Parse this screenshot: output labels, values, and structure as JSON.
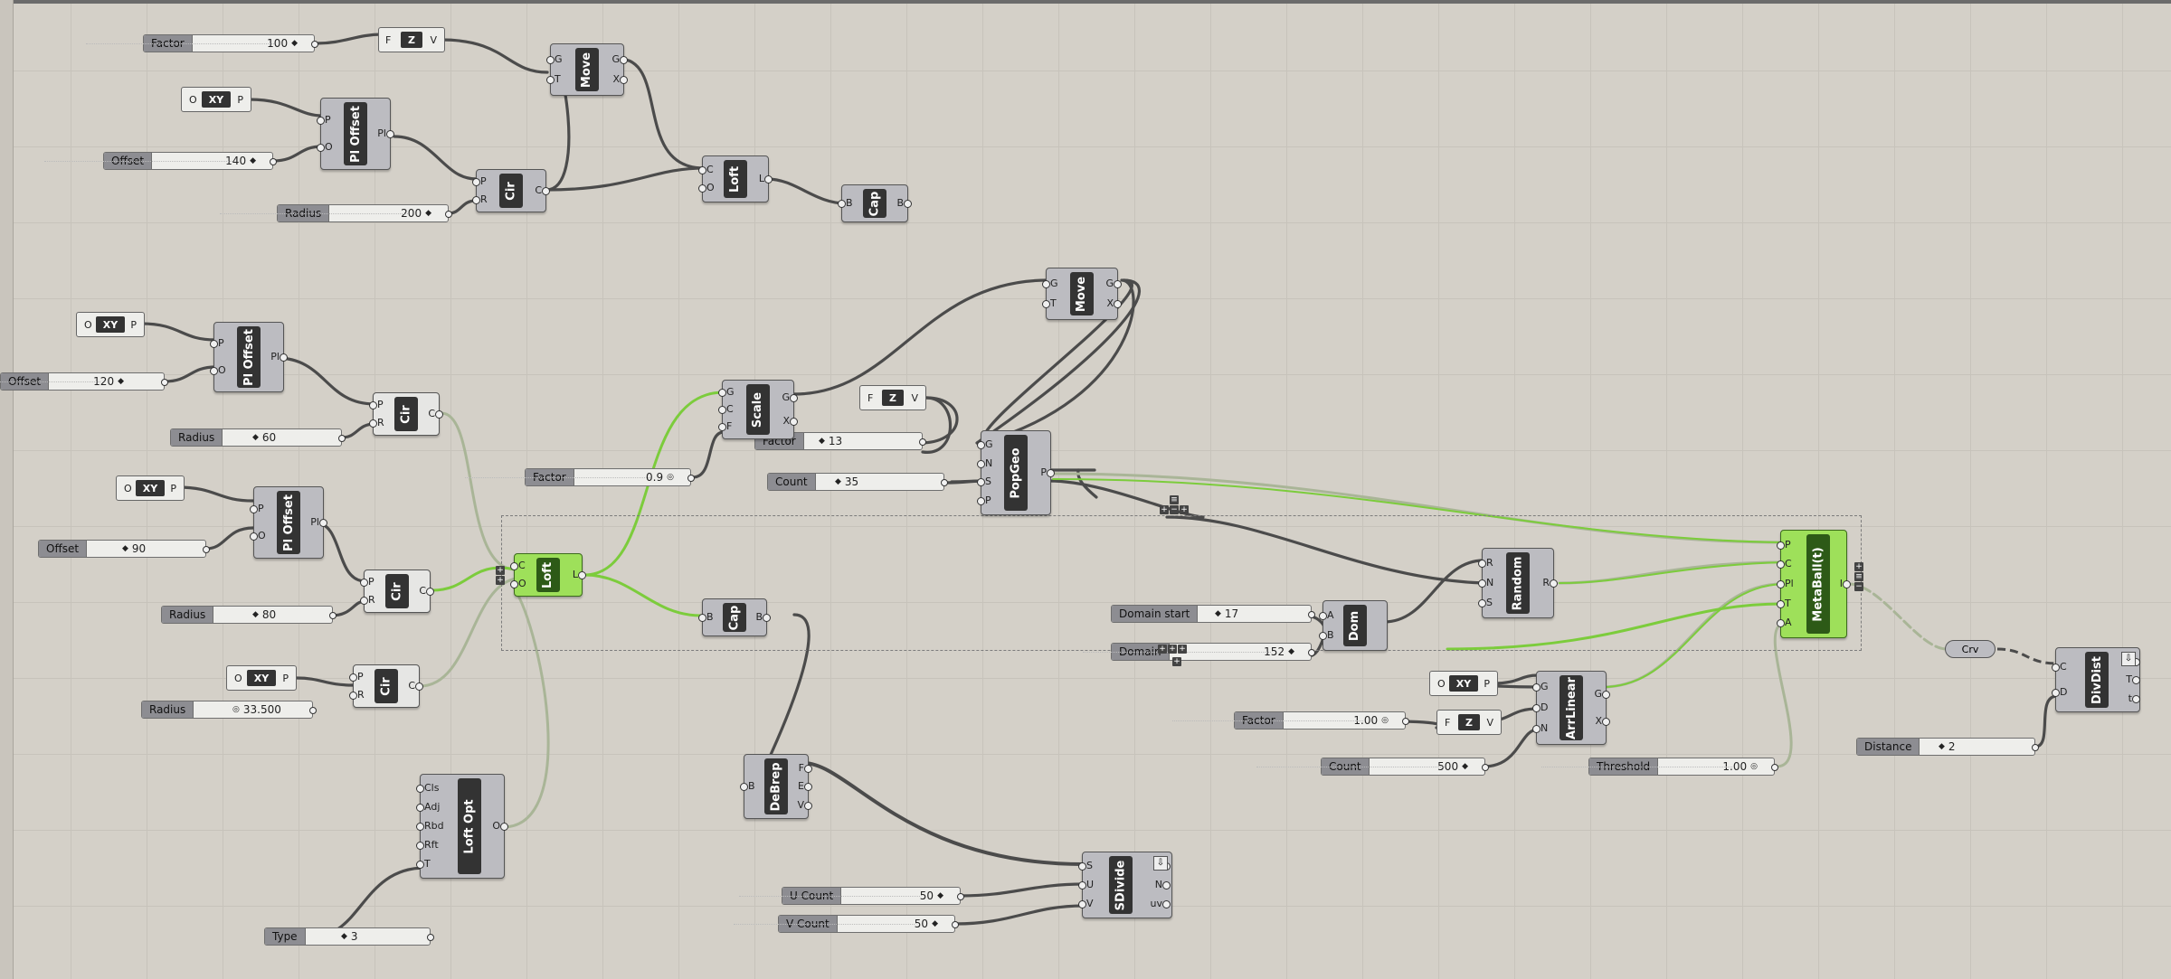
{
  "canvas": {
    "background": "#d4d0c8",
    "wire_color": "#4b4b4b",
    "selected_wire_color": "#7ccc3c",
    "selected_node_color": "#9ee05a"
  },
  "sliders": {
    "factor100": {
      "label": "Factor",
      "value": "100"
    },
    "offset140": {
      "label": "Offset",
      "value": "140"
    },
    "radius200": {
      "label": "Radius",
      "value": "200"
    },
    "offset120": {
      "label": "Offset",
      "value": "120"
    },
    "radius60": {
      "label": "Radius",
      "value": "60"
    },
    "offset90": {
      "label": "Offset",
      "value": "90"
    },
    "radius80": {
      "label": "Radius",
      "value": "80"
    },
    "radius33": {
      "label": "Radius",
      "value": "33.500"
    },
    "type3": {
      "label": "Type",
      "value": "3"
    },
    "factor09": {
      "label": "Factor",
      "value": "0.9"
    },
    "factor13": {
      "label": "Factor",
      "value": "13"
    },
    "count35": {
      "label": "Count",
      "value": "35"
    },
    "domainStart": {
      "label": "Domain start",
      "value": "17"
    },
    "domainEnd": {
      "label": "Domain",
      "value": "152"
    },
    "factor100b": {
      "label": "Factor",
      "value": "1.00"
    },
    "count500": {
      "label": "Count",
      "value": "500"
    },
    "threshold": {
      "label": "Threshold",
      "value": "1.00"
    },
    "ucount": {
      "label": "U Count",
      "value": "50"
    },
    "vcount": {
      "label": "V Count",
      "value": "50"
    },
    "distance": {
      "label": "Distance",
      "value": "2"
    }
  },
  "nodes": {
    "z1": {
      "title": "Z",
      "inputs": [
        "F"
      ],
      "outputs": [
        "V"
      ]
    },
    "xy1": {
      "title": "XY",
      "inputs": [
        "O"
      ],
      "outputs": [
        "P"
      ]
    },
    "ploffset1": {
      "title": "Pl Offset",
      "inputs": [
        "P",
        "O"
      ],
      "outputs": [
        "Pl"
      ]
    },
    "move1": {
      "title": "Move",
      "inputs": [
        "G",
        "T"
      ],
      "outputs": [
        "G",
        "X"
      ]
    },
    "cir1": {
      "title": "Cir",
      "inputs": [
        "P",
        "R"
      ],
      "outputs": [
        "C"
      ]
    },
    "loft1": {
      "title": "Loft",
      "inputs": [
        "C",
        "O"
      ],
      "outputs": [
        "L"
      ]
    },
    "cap1": {
      "title": "Cap",
      "inputs": [
        "B"
      ],
      "outputs": [
        "B"
      ]
    },
    "xy2": {
      "title": "XY",
      "inputs": [
        "O"
      ],
      "outputs": [
        "P"
      ]
    },
    "ploffset2": {
      "title": "Pl Offset",
      "inputs": [
        "P",
        "O"
      ],
      "outputs": [
        "Pl"
      ]
    },
    "cir2": {
      "title": "Cir",
      "inputs": [
        "P",
        "R"
      ],
      "outputs": [
        "C"
      ]
    },
    "xy3": {
      "title": "XY",
      "inputs": [
        "O"
      ],
      "outputs": [
        "P"
      ]
    },
    "ploffset3": {
      "title": "Pl Offset",
      "inputs": [
        "P",
        "O"
      ],
      "outputs": [
        "Pl"
      ]
    },
    "cir3": {
      "title": "Cir",
      "inputs": [
        "P",
        "R"
      ],
      "outputs": [
        "C"
      ]
    },
    "xy4": {
      "title": "XY",
      "inputs": [
        "O"
      ],
      "outputs": [
        "P"
      ]
    },
    "cir4": {
      "title": "Cir",
      "inputs": [
        "P",
        "R"
      ],
      "outputs": [
        "C"
      ]
    },
    "loftopt": {
      "title": "Loft Opt",
      "inputs": [
        "Cls",
        "Adj",
        "Rbd",
        "Rft",
        "T"
      ],
      "outputs": [
        "O"
      ]
    },
    "loft2": {
      "title": "Loft",
      "inputs": [
        "C",
        "O"
      ],
      "outputs": [
        "L"
      ]
    },
    "scale": {
      "title": "Scale",
      "inputs": [
        "G",
        "C",
        "F"
      ],
      "outputs": [
        "G",
        "X"
      ]
    },
    "z2": {
      "title": "Z",
      "inputs": [
        "F"
      ],
      "outputs": [
        "V"
      ]
    },
    "move2": {
      "title": "Move",
      "inputs": [
        "G",
        "T"
      ],
      "outputs": [
        "G",
        "X"
      ]
    },
    "popgeo": {
      "title": "PopGeo",
      "inputs": [
        "G",
        "N",
        "S",
        "P"
      ],
      "outputs": [
        "P"
      ]
    },
    "cap2": {
      "title": "Cap",
      "inputs": [
        "B"
      ],
      "outputs": [
        "B"
      ]
    },
    "debrep": {
      "title": "DeBrep",
      "inputs": [
        "B"
      ],
      "outputs": [
        "F",
        "E",
        "V"
      ]
    },
    "sdivide": {
      "title": "SDivide",
      "inputs": [
        "S",
        "U",
        "V"
      ],
      "outputs": [
        "P",
        "N",
        "uv"
      ]
    },
    "dom": {
      "title": "Dom",
      "inputs": [
        "A",
        "B"
      ],
      "outputs": [
        "I"
      ]
    },
    "random": {
      "title": "Random",
      "inputs": [
        "R",
        "N",
        "S"
      ],
      "outputs": [
        "R"
      ]
    },
    "xy5": {
      "title": "XY",
      "inputs": [
        "O"
      ],
      "outputs": [
        "P"
      ]
    },
    "z3": {
      "title": "Z",
      "inputs": [
        "F"
      ],
      "outputs": [
        "V"
      ]
    },
    "arrlinear": {
      "title": "ArrLinear",
      "inputs": [
        "G",
        "D",
        "N"
      ],
      "outputs": [
        "G",
        "X"
      ]
    },
    "metaball": {
      "title": "MetaBall(t)",
      "inputs": [
        "P",
        "C",
        "Pl",
        "T",
        "A"
      ],
      "outputs": [
        "I"
      ]
    },
    "crv": {
      "title": "Crv"
    },
    "divdist": {
      "title": "DivDist",
      "inputs": [
        "C",
        "D"
      ],
      "outputs": [
        "P",
        "T",
        "t"
      ]
    }
  }
}
